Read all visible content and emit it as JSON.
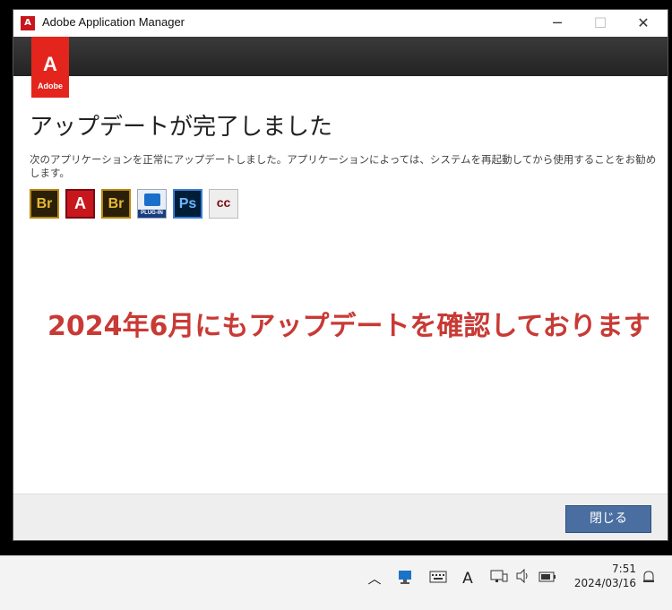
{
  "window": {
    "title": "Adobe Application Manager",
    "min_glyph": "─",
    "max_glyph": "☐",
    "close_glyph": "✕",
    "logo_word": "Adobe",
    "logo_mark": "A"
  },
  "content": {
    "heading": "アップデートが完了しました",
    "description": "次のアプリケーションを正常にアップデートしました。アプリケーションによっては、システムを再起動してから使用することをお勧めします。",
    "apps": [
      {
        "name": "bridge-icon",
        "text": "Br"
      },
      {
        "name": "adobe-icon",
        "text": "A"
      },
      {
        "name": "bridge-icon",
        "text": "Br"
      },
      {
        "name": "plugin-icon",
        "text": "PLUG-IN"
      },
      {
        "name": "photoshop-icon",
        "text": "Ps"
      },
      {
        "name": "creative-cloud-icon",
        "text": "cc"
      }
    ],
    "overlay_note": "2024年6月にもアップデートを確認しております"
  },
  "footer": {
    "close_label": "閉じる"
  },
  "taskbar": {
    "chevron": "︿",
    "input_indicator": "A",
    "time": "7:51",
    "date": "2024/03/16"
  },
  "colors": {
    "accent": "#e3251e",
    "button": "#4a6ea0",
    "overlay_text": "#c83a35"
  }
}
